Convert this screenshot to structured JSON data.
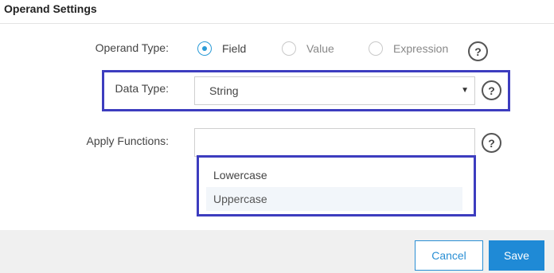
{
  "dialog": {
    "title": "Operand Settings"
  },
  "form": {
    "operand_type_label": "Operand Type:",
    "operand_types": [
      {
        "label": "Field",
        "selected": true
      },
      {
        "label": "Value",
        "selected": false
      },
      {
        "label": "Expression",
        "selected": false
      }
    ],
    "data_type_label": "Data Type:",
    "data_type_value": "String",
    "apply_functions_label": "Apply Functions:",
    "apply_functions_value": "",
    "function_options": [
      "Lowercase",
      "Uppercase"
    ],
    "help_glyph": "?"
  },
  "footer": {
    "cancel_label": "Cancel",
    "save_label": "Save"
  },
  "colors": {
    "accent": "#2a9bd7",
    "highlight_border": "#3d3dbf",
    "save_button": "#1f8ad6",
    "footer_bg": "#f0f0f0"
  }
}
